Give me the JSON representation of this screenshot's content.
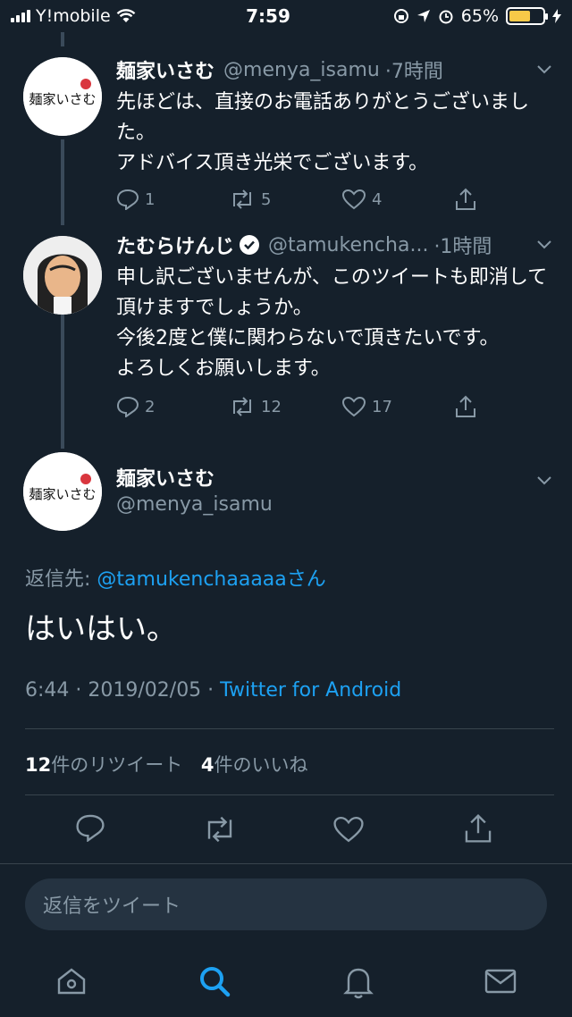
{
  "status_bar": {
    "carrier": "Y!mobile",
    "time": "7:59",
    "battery_percent": "65%",
    "battery_level": 0.65
  },
  "tweets": [
    {
      "name": "麺家いさむ",
      "handle": "@menya_isamu",
      "time": "·7時間",
      "text": "先ほどは、直接のお電話ありがとうございました。\nアドバイス頂き光栄でございます。",
      "reply_count": "1",
      "retweet_count": "5",
      "like_count": "4",
      "avatar_text": "麺家いさむ"
    },
    {
      "name": "たむらけんじ",
      "handle": "@tamukencha...",
      "time": "·1時間",
      "text": "申し訳ございませんが、このツイートも即消して頂けますでしょうか。\n今後2度と僕に関わらないで頂きたいです。\nよろしくお願いします。",
      "reply_count": "2",
      "retweet_count": "12",
      "like_count": "17"
    }
  ],
  "main_tweet": {
    "name": "麺家いさむ",
    "handle": "@menya_isamu",
    "reply_to_label": "返信先: ",
    "reply_to_handle": "@tamukenchaaaaaさん",
    "text": "はいはい。",
    "timestamp": "6:44 · 2019/02/05 · ",
    "client": "Twitter for Android",
    "retweets_count": "12",
    "retweets_label": "件のリツイート",
    "likes_count": "4",
    "likes_label": "件のいいね"
  },
  "reply": {
    "placeholder": "返信をツイート"
  },
  "colors": {
    "background": "#15202b",
    "accent": "#1da1f2",
    "muted": "#8899a6"
  }
}
